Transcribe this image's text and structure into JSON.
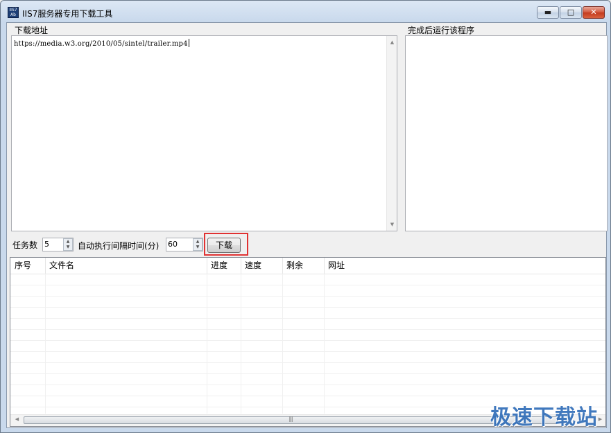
{
  "window": {
    "title": "IIS7服务器专用下载工具",
    "icon_text": "IIS7 Ab",
    "minimize_glyph": "▬",
    "maximize_glyph": "□",
    "close_glyph": "✕"
  },
  "download": {
    "label": "下载地址",
    "url": "https://media.w3.org/2010/05/sintel/trailer.mp4"
  },
  "post_run": {
    "label": "完成后运行该程序",
    "value": ""
  },
  "controls": {
    "tasks_label": "任务数",
    "tasks_value": "5",
    "interval_label": "自动执行间隔时间(分)",
    "interval_value": "60",
    "download_button": "下载"
  },
  "table": {
    "columns": [
      "序号",
      "文件名",
      "进度",
      "速度",
      "剩余",
      "网址"
    ],
    "rows": []
  },
  "scrollbars": {
    "up_glyph": "▲",
    "down_glyph": "▼",
    "left_glyph": "◀",
    "right_glyph": "▶",
    "grip_glyph": "|||"
  },
  "watermark": "极速下载站",
  "colors": {
    "highlight": "#e03232",
    "watermark": "#2d6bb7"
  }
}
